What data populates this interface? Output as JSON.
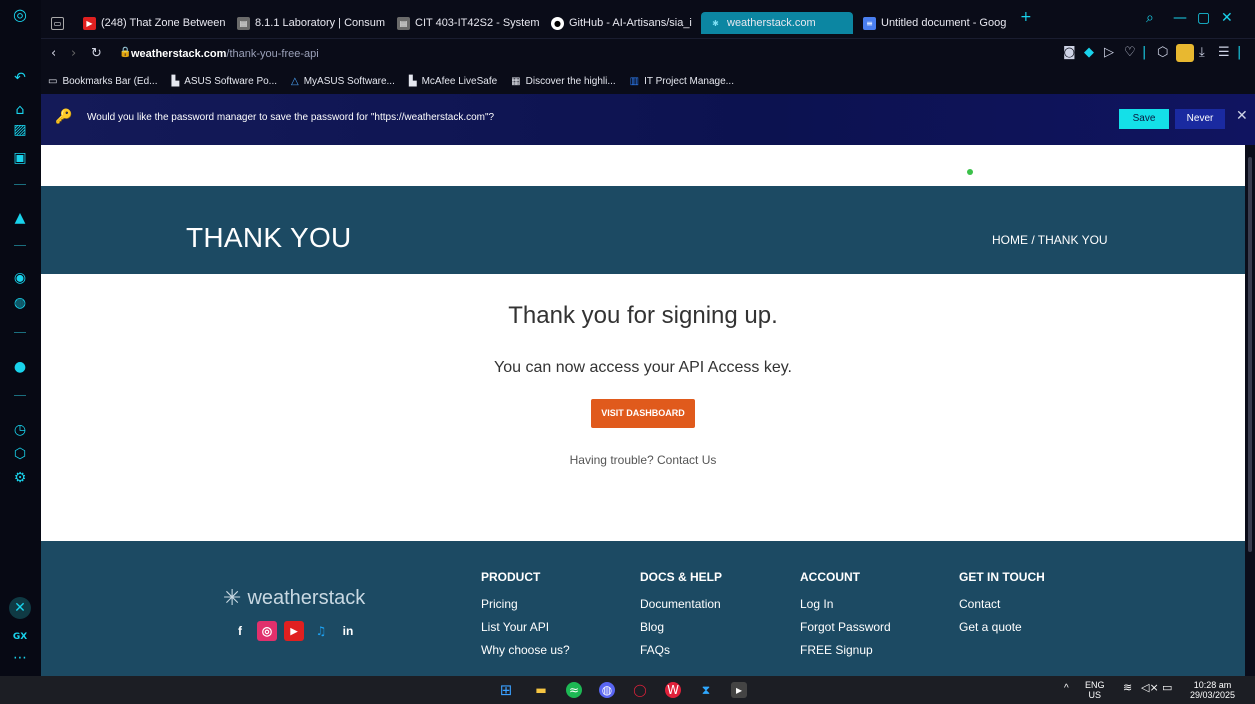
{
  "tabs": [
    {
      "label": "(248) That Zone Between",
      "icon": "youtube-icon",
      "color": "#e02020"
    },
    {
      "label": "8.1.1 Laboratory | Consum",
      "icon": "cisco-icon",
      "color": "#6b6b6b"
    },
    {
      "label": "CIT 403-IT42S2 - System",
      "icon": "cisco-icon",
      "color": "#6b6b6b"
    },
    {
      "label": "GitHub - AI-Artisans/sia_i",
      "icon": "github-icon",
      "color": "#ffffff"
    },
    {
      "label": "weatherstack.com",
      "icon": "weatherstack-icon",
      "color": "#0c86a2"
    },
    {
      "label": "Untitled document - Goog",
      "icon": "docs-icon",
      "color": "#4a7ff0"
    }
  ],
  "address": {
    "domain": "weatherstack.com",
    "path": "/thank-you-free-api"
  },
  "bookmarks": [
    {
      "label": "Bookmarks Bar (Ed...",
      "icon": "folder-icon"
    },
    {
      "label": "ASUS Software Po...",
      "icon": "file-icon"
    },
    {
      "label": "MyASUS Software...",
      "icon": "myasus-icon"
    },
    {
      "label": "McAfee LiveSafe",
      "icon": "file-icon"
    },
    {
      "label": "Discover the highli...",
      "icon": "grid-icon"
    },
    {
      "label": "IT Project Manage...",
      "icon": "trello-icon"
    }
  ],
  "password_bar": {
    "message": "Would you like the password manager to save the password for \"https://weatherstack.com\"?",
    "save": "Save",
    "never": "Never"
  },
  "hero": {
    "title": "THANK YOU",
    "breadcrumb": "HOME / THANK YOU"
  },
  "content": {
    "heading": "Thank you for signing up.",
    "subheading": "You can now access your API Access key.",
    "button": "VISIT DASHBOARD",
    "trouble": "Having trouble? Contact Us"
  },
  "footer": {
    "logo": "weatherstack",
    "columns": [
      {
        "title": "PRODUCT",
        "links": [
          "Pricing",
          "List Your API",
          "Why choose us?"
        ]
      },
      {
        "title": "DOCS & HELP",
        "links": [
          "Documentation",
          "Blog",
          "FAQs"
        ]
      },
      {
        "title": "ACCOUNT",
        "links": [
          "Log In",
          "Forgot Password",
          "FREE Signup"
        ]
      },
      {
        "title": "GET IN TOUCH",
        "links": [
          "Contact",
          "Get a quote"
        ]
      }
    ]
  },
  "taskbar": {
    "lang_top": "ENG",
    "lang_bottom": "US",
    "time": "10:28 am",
    "date": "29/03/2025"
  },
  "sidebar_bottom_label": "GX"
}
